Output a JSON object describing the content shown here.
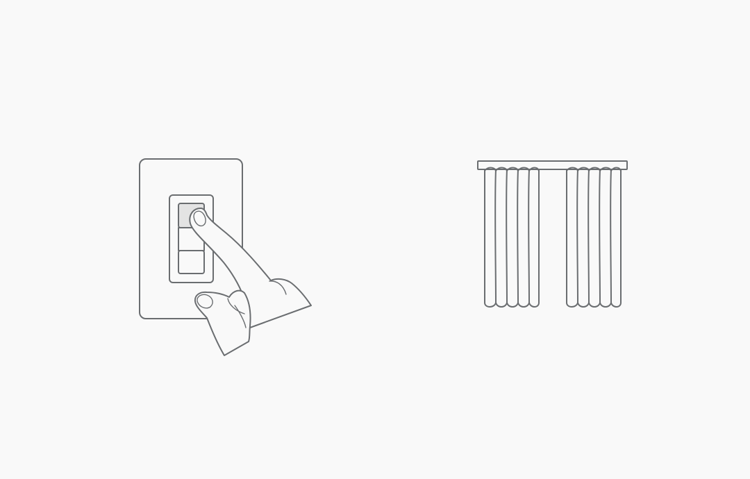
{
  "illustrations": [
    {
      "icon": "light-switch-press-icon"
    },
    {
      "icon": "curtains-icon"
    }
  ],
  "colors": {
    "background": "#f9f9f9",
    "stroke": "#6a6d70",
    "pressed_button": "#e3e3e3"
  }
}
